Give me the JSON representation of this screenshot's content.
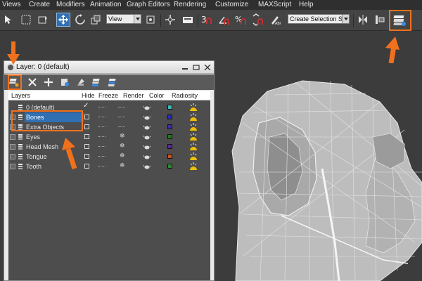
{
  "menubar": {
    "items": [
      "Views",
      "Create",
      "Modifiers",
      "Animation",
      "Graph Editors",
      "Rendering",
      "Customize",
      "MAXScript",
      "Help"
    ]
  },
  "toolbar": {
    "reference_coord_select": "View",
    "named_selection_select": "Create Selection Se",
    "snap_label": "3",
    "angle_snap_label": "",
    "percent_snap_label": "%",
    "spinner_snap_label": "n",
    "accent_color": "#f0711c"
  },
  "layer_dialog": {
    "title": "Layer: 0 (default)",
    "columns": [
      "Layers",
      "Hide",
      "Freeze",
      "Render",
      "Color",
      "Radiosity"
    ],
    "rows": [
      {
        "name": "0 (default)",
        "expandable": false,
        "current": true,
        "selected": false,
        "hide": "check",
        "freeze": "dash",
        "color": "#3fb9b9"
      },
      {
        "name": "Bones",
        "expandable": true,
        "current": false,
        "selected": true,
        "hide": "box",
        "freeze": "dash",
        "color": "#2a2ab8"
      },
      {
        "name": "Extra Objects",
        "expandable": true,
        "current": false,
        "selected": false,
        "hide": "box",
        "freeze": "dash",
        "color": "#3b2ea8"
      },
      {
        "name": "Eyes",
        "expandable": true,
        "current": false,
        "selected": false,
        "hide": "box",
        "freeze": "snowflake",
        "color": "#1f7a1f"
      },
      {
        "name": "Head Mesh",
        "expandable": true,
        "current": false,
        "selected": false,
        "hide": "box",
        "freeze": "snowflake",
        "color": "#5a2a9a"
      },
      {
        "name": "Tongue",
        "expandable": true,
        "current": false,
        "selected": false,
        "hide": "box",
        "freeze": "snowflake",
        "color": "#c8511f"
      },
      {
        "name": "Tooth",
        "expandable": true,
        "current": false,
        "selected": false,
        "hide": "box",
        "freeze": "snowflake",
        "color": "#2e8b2e"
      }
    ]
  }
}
